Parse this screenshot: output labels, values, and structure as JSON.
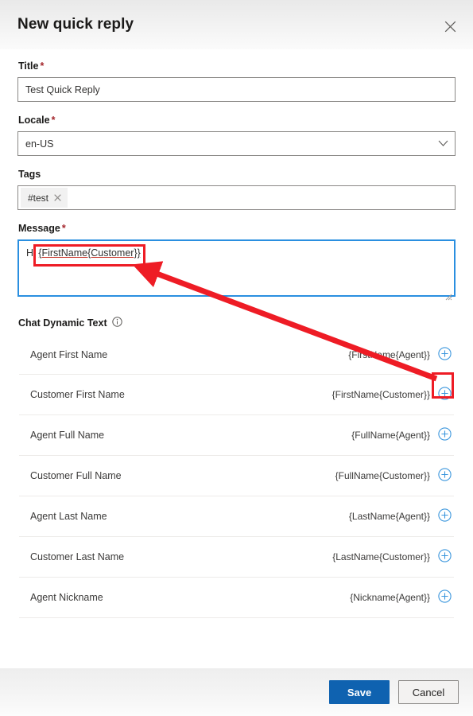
{
  "header": {
    "title": "New quick reply",
    "close_icon": "close-icon"
  },
  "form": {
    "title_field": {
      "label": "Title",
      "required_mark": "*",
      "value": "Test Quick Reply"
    },
    "locale_field": {
      "label": "Locale",
      "required_mark": "*",
      "value": "en-US",
      "chevron_icon": "chevron-down-icon"
    },
    "tags_field": {
      "label": "Tags",
      "chips": [
        {
          "text": "#test",
          "remove_icon": "close-icon"
        }
      ]
    },
    "message_field": {
      "label": "Message",
      "required_mark": "*",
      "value": "Hi {FirstName{Customer}}",
      "prefix_text": "Hi ",
      "token_text": "{FirstName{Customer}}"
    }
  },
  "dynamic_text": {
    "section_label": "Chat Dynamic Text",
    "info_icon": "info-icon",
    "add_icon": "add-circle-icon",
    "rows": [
      {
        "label": "Agent First Name",
        "token": "{FirstName{Agent}}"
      },
      {
        "label": "Customer First Name",
        "token": "{FirstName{Customer}}"
      },
      {
        "label": "Agent Full Name",
        "token": "{FullName{Agent}}"
      },
      {
        "label": "Customer Full Name",
        "token": "{FullName{Customer}}"
      },
      {
        "label": "Agent Last Name",
        "token": "{LastName{Agent}}"
      },
      {
        "label": "Customer Last Name",
        "token": "{LastName{Customer}}"
      },
      {
        "label": "Agent Nickname",
        "token": "{Nickname{Agent}}"
      }
    ]
  },
  "footer": {
    "save_label": "Save",
    "cancel_label": "Cancel"
  },
  "annotation": {
    "color": "#ee1c25",
    "arrow_from": "add-button-of-customer-first-name",
    "arrow_to": "message-textarea-token"
  },
  "colors": {
    "accent_blue": "#0f62b0",
    "focus_blue": "#2a8fe0",
    "required_red": "#a4262c",
    "annotation_red": "#ee1c25",
    "header_gray": "#eeeeee"
  }
}
